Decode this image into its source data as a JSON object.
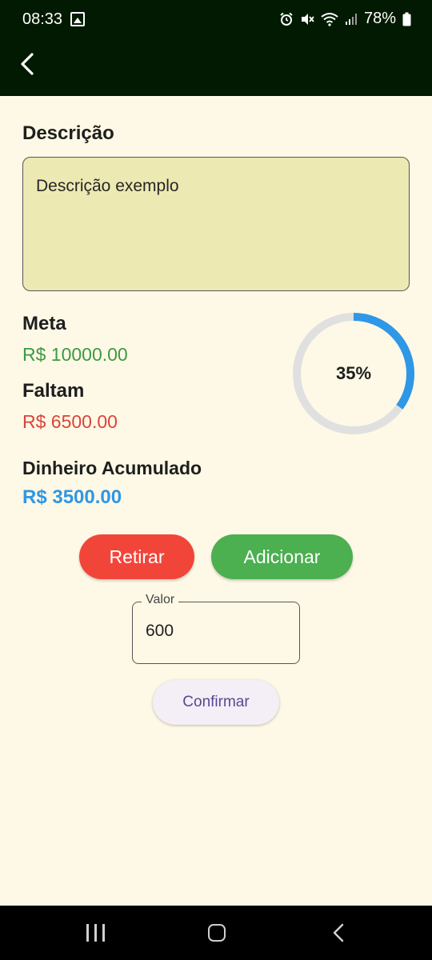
{
  "status_bar": {
    "time": "08:33",
    "battery": "78%",
    "icons": [
      "gallery-icon",
      "alarm-icon",
      "mute-icon",
      "wifi-icon",
      "signal-icon",
      "battery-icon"
    ]
  },
  "header": {
    "back_icon": "chevron-left-icon"
  },
  "description": {
    "label": "Descrição",
    "value": "Descrição exemplo"
  },
  "goal": {
    "meta_label": "Meta",
    "meta_value": "R$ 10000.00",
    "faltam_label": "Faltam",
    "faltam_value": "R$ 6500.00",
    "progress_text": "35%",
    "progress_fraction": 0.35
  },
  "accumulated": {
    "label": "Dinheiro Acumulado",
    "value": "R$ 3500.00"
  },
  "actions": {
    "retirar_label": "Retirar",
    "adicionar_label": "Adicionar"
  },
  "valor_field": {
    "label": "Valor",
    "value": "600"
  },
  "confirm": {
    "label": "Confirmar"
  },
  "colors": {
    "header_bg": "#021A02",
    "page_bg": "#FEF9E6",
    "meta_green": "#3D9A41",
    "faltam_red": "#D9443A",
    "accumulated_blue": "#2E97E6",
    "retirar_button": "#F2453A",
    "adicionar_button": "#4CAF50",
    "progress_track": "#E0E0E0",
    "progress_fill": "#2E97E6"
  },
  "nav_bar": {
    "icons": [
      "recents-icon",
      "home-icon",
      "back-icon"
    ]
  }
}
